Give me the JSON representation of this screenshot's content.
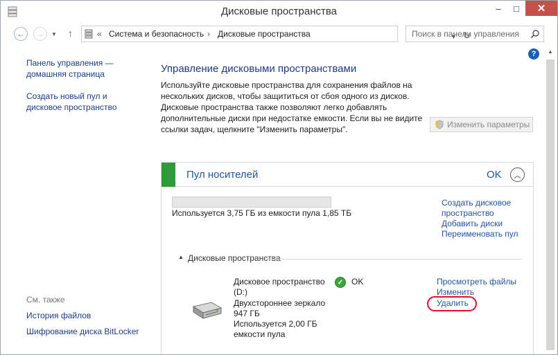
{
  "window": {
    "title": "Дисковые пространства",
    "controls": {
      "minimize": "–",
      "maximize": "□",
      "close": "✕"
    }
  },
  "address_bar": {
    "prefix": "«",
    "crumbs": [
      "Система и безопасность",
      "Дисковые пространства"
    ],
    "separator": "›"
  },
  "search": {
    "placeholder": "Поиск в панели управления"
  },
  "help": {
    "label": "?"
  },
  "left_pane": {
    "links": [
      "Панель управления —\nдомашняя страница",
      "Создать новый пул и\nдисковое пространство"
    ],
    "see_also_title": "См. также",
    "see_also_links": [
      "История файлов",
      "Шифрование диска BitLocker"
    ]
  },
  "main": {
    "title": "Управление дисковыми пространствами",
    "description": "Используйте дисковые пространства для сохранения файлов на нескольких дисков, чтобы защититься от сбоя одного из дисков. Дисковые пространства также позволяют легко добавлять дополнительные диски при недостатке емкости. Если вы не видите ссылки задач, щелкните \"Изменить параметры\".",
    "change_settings_button": "Изменить параметры"
  },
  "pool": {
    "name": "Пул носителей",
    "status": "OK",
    "usage_fraction": 0.0,
    "usage_text": "Используется 3,75 ГБ из емкости пула 1,85 ТБ",
    "links": [
      "Создать дисковое",
      "пространство",
      "Добавить диски",
      "Переименовать пул"
    ],
    "spaces_section_title": "Дисковые пространства",
    "spaces": [
      {
        "name_line1": "Дисковое пространство",
        "name_line2": "(D:)",
        "status": "OK",
        "resiliency": "Двухстороннее зеркало",
        "capacity": "947 ГБ",
        "used_line1": "Используется 2,00 ГБ",
        "used_line2": "емкости пула",
        "links": [
          "Просмотреть файлы",
          "Изменить",
          "Удалить"
        ]
      }
    ]
  },
  "colors": {
    "link": "#1f56a8",
    "pool_ok_bar": "#2f9a3a",
    "close_button": "#c7504b",
    "highlight": "#e3102b"
  }
}
